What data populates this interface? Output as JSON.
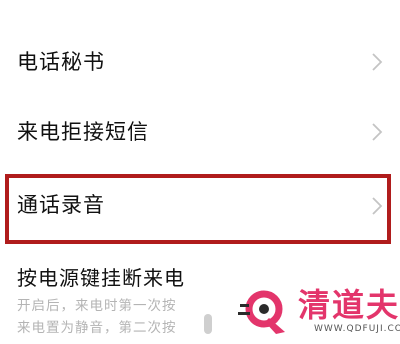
{
  "settings": {
    "items": [
      {
        "label": "电话秘书"
      },
      {
        "label": "来电拒接短信"
      },
      {
        "label": "通话录音"
      },
      {
        "label": "按电源键挂断来电",
        "description_lines": [
          "开启后，来电时第一次按",
          "来电置为静音，第二次按"
        ]
      }
    ]
  },
  "icons": {
    "chevron": "chevron-right-icon",
    "watermark_logo": "q-logo-icon"
  },
  "watermark": {
    "brand": "清道夫",
    "url": "WWW.QDFUJI.COM"
  },
  "colors": {
    "highlight_border": "#b01c1c",
    "watermark_brand": "#e3356b"
  }
}
